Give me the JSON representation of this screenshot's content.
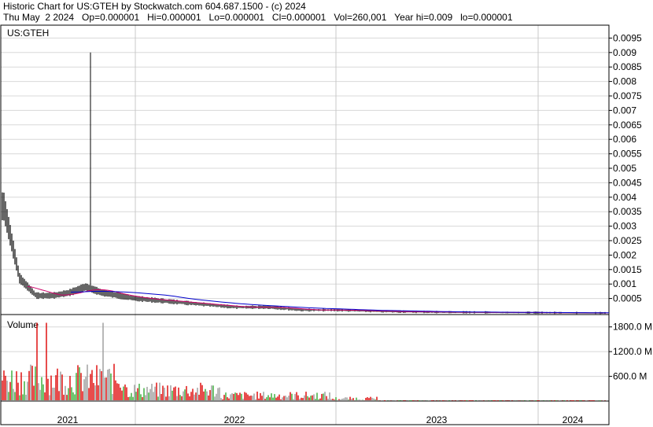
{
  "header": {
    "line1": "Historic Chart for US:GTEH by Stockwatch.com 604.687.1500 - (c) 2024",
    "line2": "Thu May  2 2024   Op=0.000001   Hi=0.000001   Lo=0.000001   Cl=0.000001   Vol=260,001   Year hi=0.009   lo=0.000001"
  },
  "colors": {
    "price": "#000000",
    "ma_short": "#cc0066",
    "ma_long": "#0000cc",
    "vol_up": "#33aa33",
    "vol_down": "#dd0000",
    "vol_flat": "#999999",
    "grid": "#d8d8d8"
  },
  "chart_data": [
    {
      "type": "line",
      "title": "US:GTEH",
      "xlabel": "",
      "ylabel": "",
      "ylim": [
        0,
        0.01
      ],
      "y_ticks": [
        "0.0005",
        "0.001",
        "0.0015",
        "0.002",
        "0.0025",
        "0.003",
        "0.0035",
        "0.004",
        "0.0045",
        "0.005",
        "0.0055",
        "0.006",
        "0.0065",
        "0.007",
        "0.0075",
        "0.008",
        "0.0085",
        "0.009",
        "0.0095"
      ],
      "x_tick_labels": [
        "2021",
        "2022",
        "2023",
        "2024"
      ],
      "x": [
        "2021-03",
        "2021-04",
        "2021-05",
        "2021-06",
        "2021-07",
        "2021-08",
        "2021-09",
        "2021-10",
        "2021-11",
        "2021-12",
        "2022-01",
        "2022-03",
        "2022-05",
        "2022-07",
        "2022-09",
        "2022-11",
        "2023-01",
        "2023-04",
        "2023-07",
        "2023-10",
        "2024-01",
        "2024-04"
      ],
      "series": [
        {
          "values": [
            0.0012,
            0.0014,
            0.0038,
            0.0012,
            0.0006,
            0.0006,
            0.0007,
            0.0009,
            0.0007,
            0.0006,
            0.0005,
            0.0004,
            0.0003,
            0.0002,
            0.0002,
            0.0001,
            0.0001,
            5e-05,
            3e-05,
            2e-05,
            1e-05,
            1e-06
          ]
        }
      ],
      "spike": {
        "x": "2021-10",
        "high": 0.009
      },
      "grid": true
    },
    {
      "type": "bar",
      "title": "Volume",
      "y_ticks": [
        "600.0 M",
        "1800.0 M",
        "1200.0 M"
      ],
      "y_tick_values": [
        600,
        1800,
        1200
      ],
      "ylim": [
        0,
        2100
      ],
      "note": "volume in millions"
    }
  ]
}
